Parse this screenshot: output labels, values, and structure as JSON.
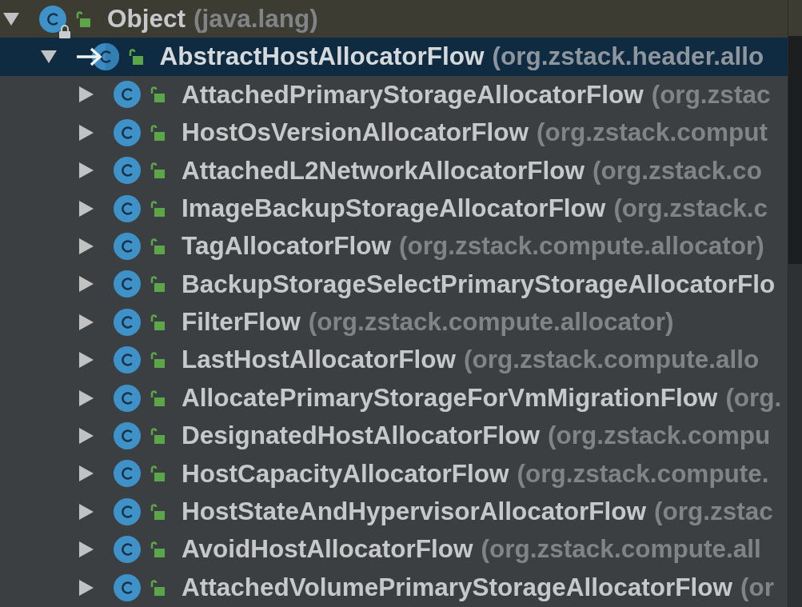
{
  "hierarchy": {
    "nodes": [
      {
        "name": "Object",
        "package": "(java.lang)",
        "kind": "class",
        "library": true,
        "base": false,
        "expanded": true,
        "selected": false,
        "children": [
          {
            "name": "AbstractHostAllocatorFlow",
            "package": "(org.zstack.header.allo",
            "kind": "abstract_class",
            "library": false,
            "base": true,
            "expanded": true,
            "selected": true,
            "children": [
              {
                "name": "AttachedPrimaryStorageAllocatorFlow",
                "package": "(org.zstac",
                "kind": "class",
                "library": false,
                "base": false,
                "expanded": false,
                "selected": false
              },
              {
                "name": "HostOsVersionAllocatorFlow",
                "package": "(org.zstack.comput",
                "kind": "class",
                "library": false,
                "base": false,
                "expanded": false,
                "selected": false
              },
              {
                "name": "AttachedL2NetworkAllocatorFlow",
                "package": "(org.zstack.co",
                "kind": "class",
                "library": false,
                "base": false,
                "expanded": false,
                "selected": false
              },
              {
                "name": "ImageBackupStorageAllocatorFlow",
                "package": "(org.zstack.c",
                "kind": "class",
                "library": false,
                "base": false,
                "expanded": false,
                "selected": false
              },
              {
                "name": "TagAllocatorFlow",
                "package": "(org.zstack.compute.allocator)",
                "kind": "class",
                "library": false,
                "base": false,
                "expanded": false,
                "selected": false
              },
              {
                "name": "BackupStorageSelectPrimaryStorageAllocatorFlo",
                "kind": "class",
                "library": false,
                "base": false,
                "expanded": false,
                "selected": false
              },
              {
                "name": "FilterFlow",
                "package": "(org.zstack.compute.allocator)",
                "kind": "class",
                "library": false,
                "base": false,
                "expanded": false,
                "selected": false
              },
              {
                "name": "LastHostAllocatorFlow",
                "package": "(org.zstack.compute.allo",
                "kind": "class",
                "library": false,
                "base": false,
                "expanded": false,
                "selected": false
              },
              {
                "name": "AllocatePrimaryStorageForVmMigrationFlow",
                "package": "(org.",
                "kind": "class",
                "library": false,
                "base": false,
                "expanded": false,
                "selected": false
              },
              {
                "name": "DesignatedHostAllocatorFlow",
                "package": "(org.zstack.compu",
                "kind": "class",
                "library": false,
                "base": false,
                "expanded": false,
                "selected": false
              },
              {
                "name": "HostCapacityAllocatorFlow",
                "package": "(org.zstack.compute.",
                "kind": "class",
                "library": false,
                "base": false,
                "expanded": false,
                "selected": false
              },
              {
                "name": "HostStateAndHypervisorAllocatorFlow",
                "package": "(org.zstac",
                "kind": "class",
                "library": false,
                "base": false,
                "expanded": false,
                "selected": false
              },
              {
                "name": "AvoidHostAllocatorFlow",
                "package": "(org.zstack.compute.all",
                "kind": "class",
                "library": false,
                "base": false,
                "expanded": false,
                "selected": false
              },
              {
                "name": "AttachedVolumePrimaryStorageAllocatorFlow",
                "package": "(or",
                "kind": "class",
                "library": false,
                "base": false,
                "expanded": false,
                "selected": false
              }
            ]
          }
        ]
      }
    ]
  }
}
